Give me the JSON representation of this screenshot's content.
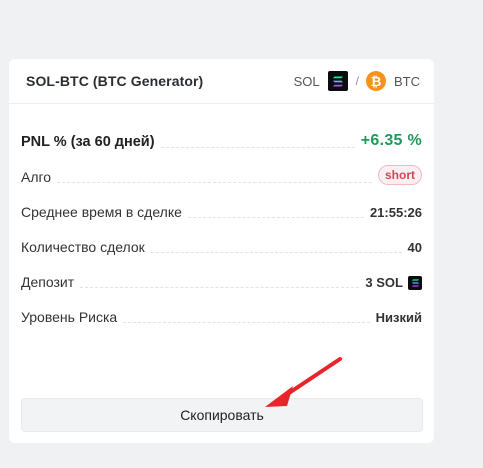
{
  "card": {
    "title": "SOL-BTC (BTC Generator)",
    "base": "SOL",
    "separator": "/",
    "quote": "BTC"
  },
  "rows": [
    {
      "label": "PNL % (за 60 дней)",
      "value": "+6.35 %"
    },
    {
      "label": "Алго",
      "value": "short"
    },
    {
      "label": "Среднее время в сделке",
      "value": "21:55:26"
    },
    {
      "label": "Количество сделок",
      "value": "40"
    },
    {
      "label": "Депозит",
      "value": "3 SOL"
    },
    {
      "label": "Уровень Риска",
      "value": "Низкий"
    }
  ],
  "copy_button": "Скопировать",
  "colors": {
    "positive": "#1e9a5b",
    "short_badge": "#d9435a",
    "btc": "#f7931a",
    "arrow": "#e8262a"
  },
  "icons": [
    "solana-icon",
    "bitcoin-icon",
    "arrow-annotation"
  ]
}
